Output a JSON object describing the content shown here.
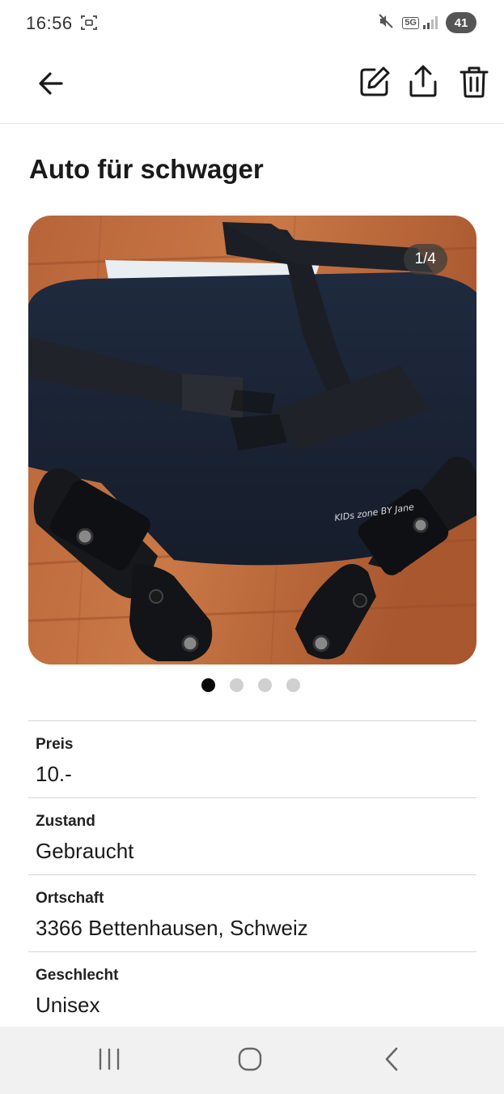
{
  "status_bar": {
    "time": "16:56",
    "battery": "41",
    "network": "5G"
  },
  "app_bar": {
    "back_icon": "arrow-left-icon",
    "edit_icon": "edit-icon",
    "share_icon": "share-icon",
    "delete_icon": "trash-icon"
  },
  "listing": {
    "title": "Auto für schwager",
    "image_counter": "1/4",
    "image_count": 4,
    "active_image": 1,
    "image_text": "KIDs zone BY Jane"
  },
  "details": [
    {
      "label": "Preis",
      "value": "10.-"
    },
    {
      "label": "Zustand",
      "value": "Gebraucht"
    },
    {
      "label": "Ortschaft",
      "value": "3366 Bettenhausen, Schweiz"
    },
    {
      "label": "Geschlecht",
      "value": "Unisex"
    }
  ],
  "nav_bar": {
    "recents_icon": "recent-apps-icon",
    "home_icon": "home-icon",
    "back_icon": "back-chevron-icon"
  },
  "colors": {
    "text": "#1a1a1a",
    "divider": "#d6d6d6",
    "dot_active": "#0a0a0a",
    "dot_inactive": "#d0d0d0",
    "nav_bg": "#f1f1f1"
  }
}
